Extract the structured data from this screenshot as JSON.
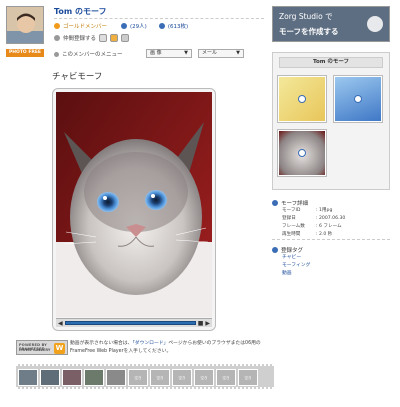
{
  "header": {
    "title": "Tom のモーフ",
    "member_type": "ゴールドメンバー",
    "count_people": "(29人)",
    "count_images": "(613枚)",
    "photo_badge": "PHOTO FREE",
    "register_label": "仲間登録する",
    "menu_label": "このメンバーのメニュー",
    "select_images_label": "画 像",
    "select_mail_label": "メール"
  },
  "page": {
    "title": "チャビモーフ"
  },
  "player": {
    "play_symbol": "▶",
    "rewind_symbol": "◀",
    "stop_symbol": "■"
  },
  "framefree": {
    "badge_line1": "POWERED BY FRAMEFREE",
    "badge_line2": "MOVIE GALLERY",
    "logo_letter": "W",
    "info_prefix": "動画が表示されない場合は、",
    "info_link": "「ダウンロード」",
    "info_suffix": "ページからお使いのブラウザまたは06用の",
    "info_line2": "FrameFree Web Playerを入手してください。"
  },
  "filmstrip": {
    "frames": [
      "",
      "",
      "",
      "",
      "",
      "空き",
      "空き",
      "空き",
      "空き",
      "空き",
      "空き"
    ]
  },
  "sidebar": {
    "banner_line1": "Zorg Studio で",
    "banner_line2": "モーフを作成する",
    "gallery_title": "Tom のモーフ",
    "details_title": "モーフ詳細",
    "details": [
      {
        "k": "モーフID",
        "v": ": 1用pg"
      },
      {
        "k": "登録日",
        "v": ": 2007.06.30"
      },
      {
        "k": "フレーム数",
        "v": ": 6 フレーム"
      },
      {
        "k": "再生時間",
        "v": ": 2.0 秒"
      }
    ],
    "tags_title": "登録タグ",
    "tags": [
      "チャビー",
      "モーフィング",
      "動画"
    ]
  },
  "colors": {
    "link": "#1a4a9a",
    "accent_orange": "#f29a1a",
    "seek_blue": "#2a6db0"
  }
}
